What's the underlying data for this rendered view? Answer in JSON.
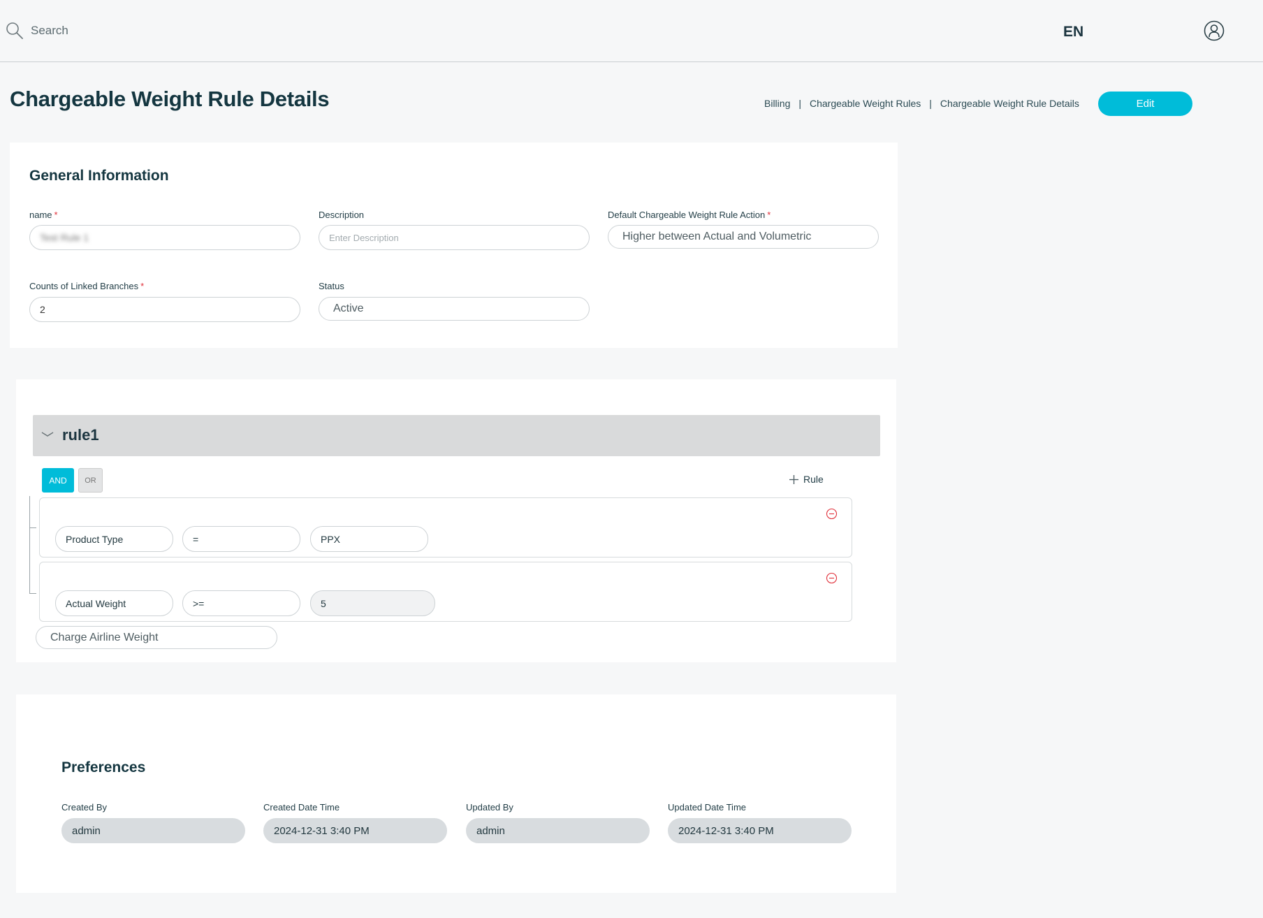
{
  "header": {
    "search_placeholder": "Search",
    "language": "EN"
  },
  "page": {
    "title": "Chargeable Weight Rule Details",
    "breadcrumb": [
      "Billing",
      "Chargeable Weight Rules",
      "Chargeable Weight Rule Details"
    ],
    "breadcrumb_separator": "|",
    "edit_label": "Edit"
  },
  "general": {
    "title": "General Information",
    "name_label": "name",
    "name_value": "Test Rule 1",
    "description_label": "Description",
    "description_placeholder": "Enter Description",
    "default_action_label": "Default Chargeable Weight Rule Action",
    "default_action_value": "Higher between Actual and Volumetric",
    "linked_branches_label": "Counts of Linked Branches",
    "linked_branches_value": "2",
    "status_label": "Status",
    "status_value": "Active",
    "required_mark": "*"
  },
  "rules": {
    "rule_name": "rule1",
    "and_label": "AND",
    "or_label": "OR",
    "add_rule_label": "Rule",
    "conditions": [
      {
        "field": "Product Type",
        "operator": "=",
        "value": "PPX"
      },
      {
        "field": "Actual Weight",
        "operator": ">=",
        "value": "5"
      }
    ],
    "action_value": "Charge Airline Weight"
  },
  "preferences": {
    "title": "Preferences",
    "created_by_label": "Created By",
    "created_by_value": "admin",
    "created_date_label": "Created Date Time",
    "created_date_value": "2024-12-31 3:40 PM",
    "updated_by_label": "Updated By",
    "updated_by_value": "admin",
    "updated_date_label": "Updated Date Time",
    "updated_date_value": "2024-12-31 3:40 PM"
  },
  "colors": {
    "accent": "#00bcd9",
    "title_text": "#143640",
    "required": "#e0303a",
    "remove": "#e0303a"
  },
  "icons": [
    "search-icon",
    "user-icon",
    "chevron-down-icon",
    "plus-icon",
    "remove-circle-icon"
  ]
}
